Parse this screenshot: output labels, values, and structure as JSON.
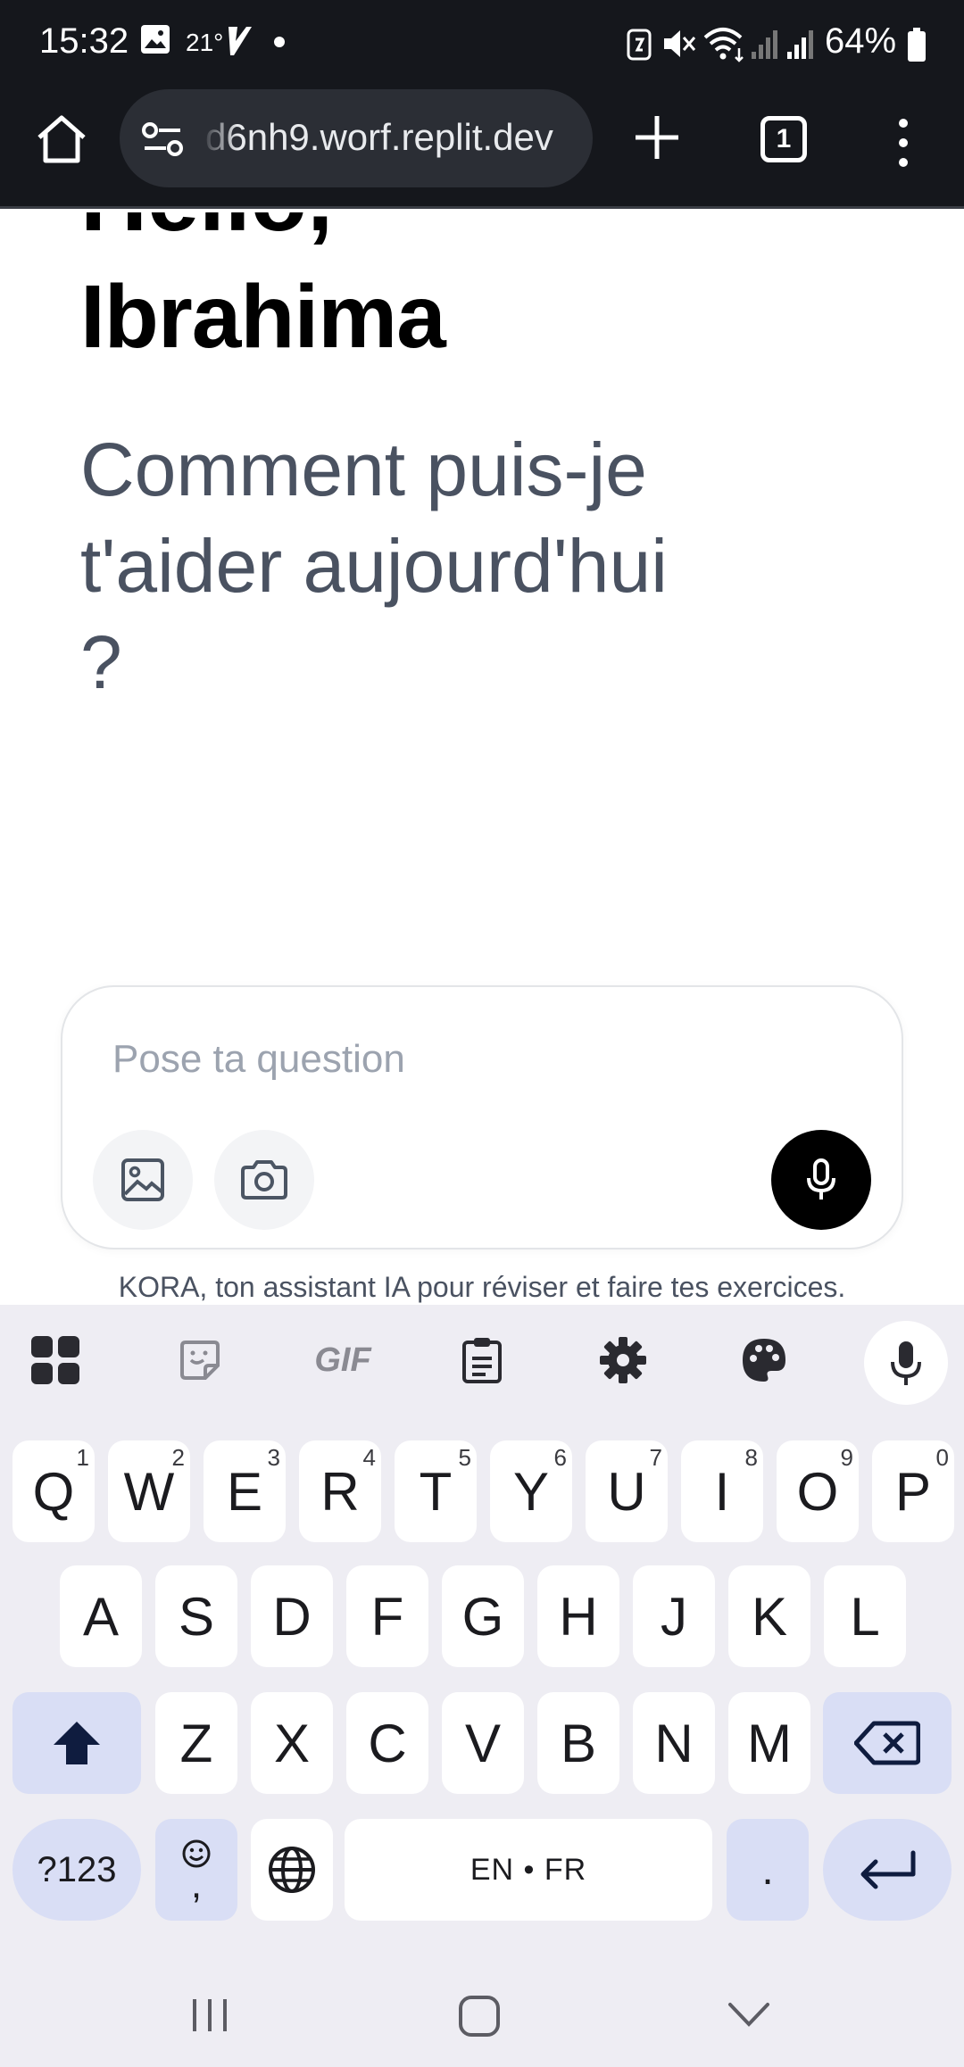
{
  "status_bar": {
    "time": "15:32",
    "temperature": "21°",
    "battery": "64%"
  },
  "browser": {
    "url": "d6nh9.worf.replit.dev",
    "tab_count": "1"
  },
  "page": {
    "greeting_line1": "Hello,",
    "greeting_name": "Ibrahima",
    "question": "Comment puis-je t'aider aujourd'hui ?",
    "input_placeholder": "Pose ta question",
    "footer_note": "KORA, ton assistant IA pour réviser et faire tes exercices."
  },
  "keyboard": {
    "toolbar_icons": [
      "apps-icon",
      "sticker-icon",
      "gif-icon",
      "clipboard-icon",
      "settings-icon",
      "palette-icon",
      "mic-icon"
    ],
    "gif_label": "GIF",
    "row1": [
      {
        "k": "Q",
        "h": "1"
      },
      {
        "k": "W",
        "h": "2"
      },
      {
        "k": "E",
        "h": "3"
      },
      {
        "k": "R",
        "h": "4"
      },
      {
        "k": "T",
        "h": "5"
      },
      {
        "k": "Y",
        "h": "6"
      },
      {
        "k": "U",
        "h": "7"
      },
      {
        "k": "I",
        "h": "8"
      },
      {
        "k": "O",
        "h": "9"
      },
      {
        "k": "P",
        "h": "0"
      }
    ],
    "row2": [
      "A",
      "S",
      "D",
      "F",
      "G",
      "H",
      "J",
      "K",
      "L"
    ],
    "row3": [
      "Z",
      "X",
      "C",
      "V",
      "B",
      "N",
      "M"
    ],
    "symbols_label": "?123",
    "emoji_comma": ",",
    "space_label": "EN • FR",
    "period_label": "."
  },
  "colors": {
    "status_bg": "#15171c",
    "question_text": "#4a5261",
    "keyboard_bg": "#eeedf3",
    "special_key": "#d9def5"
  }
}
